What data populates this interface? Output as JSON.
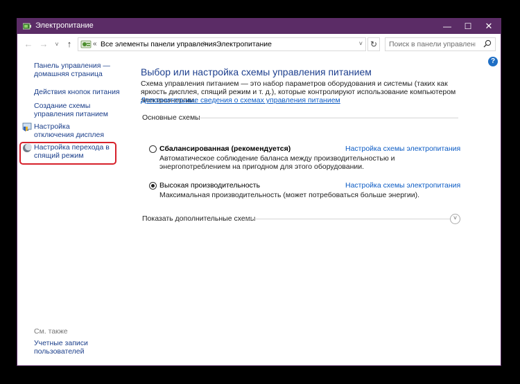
{
  "window": {
    "title": "Электропитание",
    "controls": {
      "minimize": "—",
      "maximize": "☐",
      "close": "✕"
    }
  },
  "addressbar": {
    "back": "←",
    "forward": "→",
    "recent": "˅",
    "up": "↑",
    "overflow": "«",
    "crumbs": [
      "Все элементы панели управления",
      "Электропитание"
    ],
    "separator": ">",
    "dropdown": "˅",
    "refresh": "↻",
    "search_placeholder": "Поиск в панели управления"
  },
  "help": "?",
  "sidebar": {
    "home_link": "Панель управления — домашняя страница",
    "links": [
      "Действия кнопок питания",
      "Создание схемы управления питанием",
      "Настройка отключения дисплея",
      "Настройка перехода в спящий режим"
    ],
    "see_also": "См. также",
    "user_accounts": "Учетные записи пользователей"
  },
  "main": {
    "title": "Выбор или настройка схемы управления питанием",
    "description": "Схема управления питанием — это набор параметров оборудования и системы (таких как яркость дисплея, спящий режим и т. д.), которые контролируют использование компьютером электроэнергии.",
    "details_link": "Дополнительные сведения о схемах управления питанием",
    "section_label": "Основные схемы",
    "plans": [
      {
        "name": "Сбалансированная (рекомендуется)",
        "settings_link": "Настройка схемы электропитания",
        "description": "Автоматическое соблюдение баланса между производительностью и энергопотреблением на пригодном для этого оборудовании.",
        "selected": false
      },
      {
        "name": "Высокая производительность",
        "settings_link": "Настройка схемы электропитания",
        "description": "Максимальная производительность (может потребоваться больше энергии).",
        "selected": true
      }
    ],
    "more_plans": "Показать дополнительные схемы",
    "expand": "˅"
  },
  "colors": {
    "titlebar": "#5b2c66",
    "link": "#1a3e8a",
    "heading": "#1d3f8e",
    "highlight": "#d6202a"
  }
}
